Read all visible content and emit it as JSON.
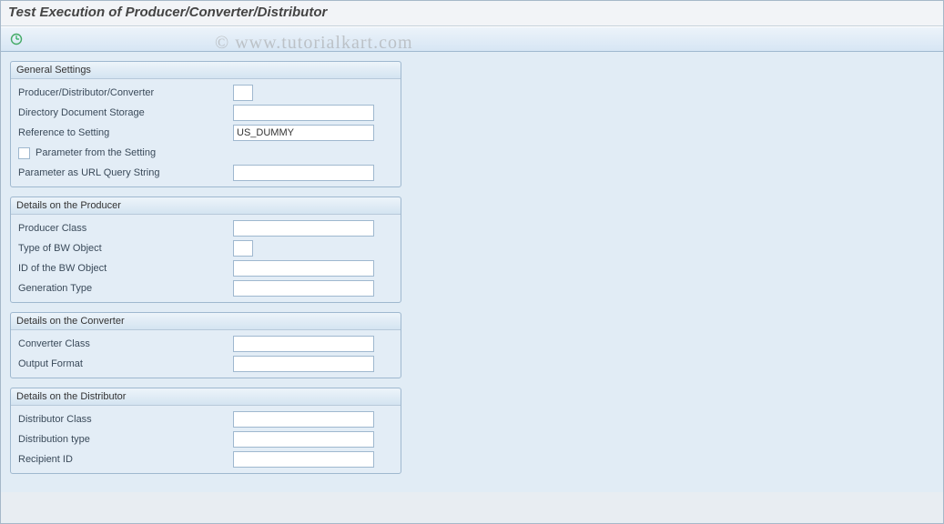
{
  "title": "Test Execution of Producer/Converter/Distributor",
  "watermark": "© www.tutorialkart.com",
  "groups": {
    "general": {
      "title": "General Settings",
      "pdc_label": "Producer/Distributor/Converter",
      "pdc_value": "",
      "dir_label": "Directory Document Storage",
      "dir_value": "",
      "ref_label": "Reference to Setting",
      "ref_value": "US_DUMMY",
      "param_setting_label": "Parameter from the Setting",
      "param_setting_checked": false,
      "param_url_label": "Parameter as URL Query String",
      "param_url_value": ""
    },
    "producer": {
      "title": "Details on the Producer",
      "class_label": "Producer Class",
      "class_value": "",
      "bwtype_label": "Type of BW Object",
      "bwtype_value": "",
      "bwid_label": "ID of the BW Object",
      "bwid_value": "",
      "gentype_label": "Generation Type",
      "gentype_value": ""
    },
    "converter": {
      "title": "Details on the Converter",
      "class_label": "Converter Class",
      "class_value": "",
      "format_label": "Output Format",
      "format_value": ""
    },
    "distributor": {
      "title": "Details on the Distributor",
      "class_label": "Distributor Class",
      "class_value": "",
      "type_label": "Distribution type",
      "type_value": "",
      "recipient_label": "Recipient ID",
      "recipient_value": ""
    }
  }
}
